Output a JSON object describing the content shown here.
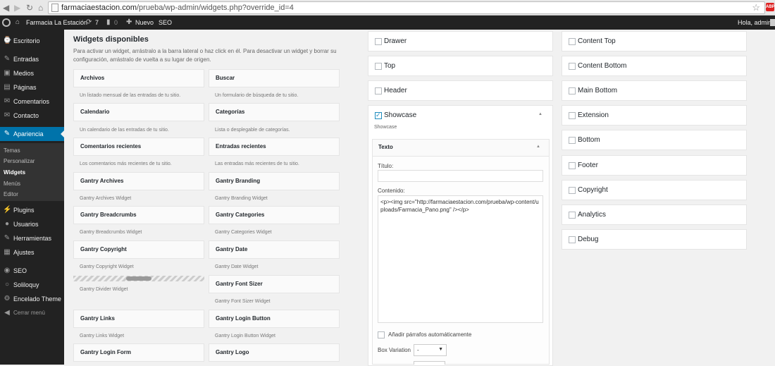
{
  "browser": {
    "url_domain": "farmaciaestacion.com",
    "url_path": "/prueba/wp-admin/widgets.php?override_id=4",
    "abp_label": "ABP"
  },
  "admin_bar": {
    "site_name": "Farmacia La Estación",
    "updates_count": "7",
    "comments_count": "0",
    "new_label": "Nuevo",
    "seo_label": "SEO",
    "greeting": "Hola, admin"
  },
  "sidebar": {
    "items": [
      {
        "label": "Escritorio",
        "icon": "dashboard-icon",
        "glyph": "⌚"
      },
      {
        "label": "Entradas",
        "icon": "pin-icon",
        "glyph": "✎"
      },
      {
        "label": "Medios",
        "icon": "media-icon",
        "glyph": "▣"
      },
      {
        "label": "Páginas",
        "icon": "pages-icon",
        "glyph": "▤"
      },
      {
        "label": "Comentarios",
        "icon": "comments-icon",
        "glyph": "✉"
      },
      {
        "label": "Contacto",
        "icon": "mail-icon",
        "glyph": "✉"
      },
      {
        "label": "Apariencia",
        "icon": "brush-icon",
        "glyph": "✎"
      },
      {
        "label": "Plugins",
        "icon": "plugins-icon",
        "glyph": "⚡"
      },
      {
        "label": "Usuarios",
        "icon": "users-icon",
        "glyph": "●"
      },
      {
        "label": "Herramientas",
        "icon": "tools-icon",
        "glyph": "✎"
      },
      {
        "label": "Ajustes",
        "icon": "settings-icon",
        "glyph": "▦"
      },
      {
        "label": "SEO",
        "icon": "seo-icon",
        "glyph": "◉"
      },
      {
        "label": "Soliloquy",
        "icon": "soliloquy-icon",
        "glyph": "○"
      },
      {
        "label": "Encelado Theme",
        "icon": "theme-icon",
        "glyph": "⚙"
      },
      {
        "label": "Cerrar menú",
        "icon": "collapse-icon",
        "glyph": "◀"
      }
    ],
    "submenu": [
      "Temas",
      "Personalizar",
      "Widgets",
      "Menús",
      "Editor"
    ]
  },
  "available": {
    "title": "Widgets disponibles",
    "description": "Para activar un widget, arrástralo a la barra lateral o haz click en él. Para desactivar un widget y borrar su configuración, arrástralo de vuelta a su lugar de origen.",
    "left": [
      {
        "title": "Archivos",
        "desc": "Un listado mensual de las entradas de tu sitio."
      },
      {
        "title": "Calendario",
        "desc": "Un calendario de las entradas de tu sitio."
      },
      {
        "title": "Comentarios recientes",
        "desc": "Los comentarios más recientes de tu sitio."
      },
      {
        "title": "Gantry Archives",
        "desc": "Gantry Archives Widget"
      },
      {
        "title": "Gantry Breadcrumbs",
        "desc": "Gantry Breadcrumbs Widget"
      },
      {
        "title": "Gantry Copyright",
        "desc": "Gantry Copyright Widget"
      },
      {
        "title": "",
        "desc": "Gantry Divider Widget"
      },
      {
        "title": "Gantry Links",
        "desc": "Gantry Links Widget"
      },
      {
        "title": "Gantry Login Form",
        "desc": ""
      }
    ],
    "right": [
      {
        "title": "Buscar",
        "desc": "Un formulario de búsqueda de tu sitio."
      },
      {
        "title": "Categorías",
        "desc": "Lista o desplegable de categorías."
      },
      {
        "title": "Entradas recientes",
        "desc": "Las entradas más recientes de tu sitio."
      },
      {
        "title": "Gantry Branding",
        "desc": "Gantry Branding Widget"
      },
      {
        "title": "Gantry Categories",
        "desc": "Gantry Categories Widget"
      },
      {
        "title": "Gantry Date",
        "desc": "Gantry Date Widget"
      },
      {
        "title": "Gantry Font Sizer",
        "desc": "Gantry Font Sizer Widget"
      },
      {
        "title": "Gantry Login Button",
        "desc": "Gantry Login Button Widget"
      },
      {
        "title": "Gantry Logo",
        "desc": ""
      }
    ]
  },
  "areas": {
    "col1": [
      "Drawer",
      "Top",
      "Header"
    ],
    "showcase": {
      "title": "Showcase",
      "description": "Showcase",
      "widget_title": "Texto",
      "title_label": "Título:",
      "title_value": "",
      "content_label": "Contenido:",
      "content_value": "<p><img src=\"http://farmaciaestacion.com/prueba/wp-content/uploads/Farmacia_Pano.png\" /></p>",
      "autop_label": "Añadir párrafos automáticamente",
      "box_variation_label": "Box Variation",
      "box_variation_value": "-"
    },
    "col2": [
      "Content Top",
      "Content Bottom",
      "Main Bottom",
      "Extension",
      "Bottom",
      "Footer",
      "Copyright",
      "Analytics",
      "Debug"
    ]
  }
}
